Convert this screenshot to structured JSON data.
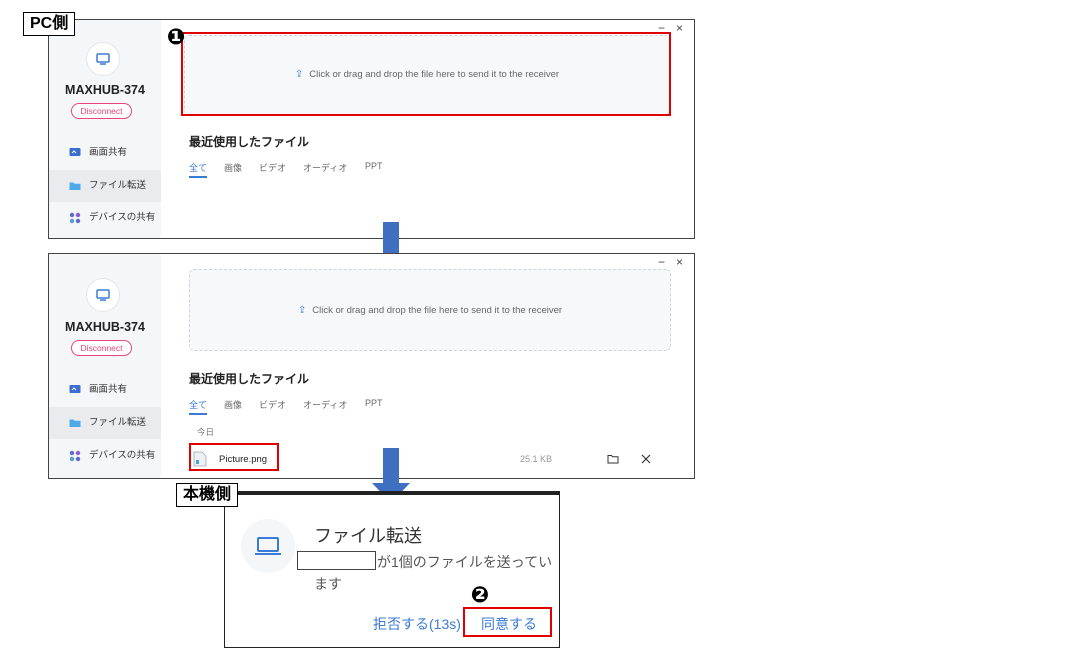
{
  "labels": {
    "pc_side": "PC側",
    "device_side": "本機側",
    "step1": "❶",
    "step2": "❷"
  },
  "window1": {
    "device_name": "MAXHUB-374",
    "disconnect": "Disconnect",
    "nav": [
      {
        "label": "画面共有",
        "icon": "screen-share-icon"
      },
      {
        "label": "ファイル転送",
        "icon": "folder-icon"
      },
      {
        "label": "デバイスの共有",
        "icon": "device-share-icon"
      }
    ],
    "dropzone_text": "Click or drag and drop the file here to send it to the receiver",
    "recent_title": "最近使用したファイル",
    "tabs": [
      "全て",
      "画像",
      "ビデオ",
      "オーディオ",
      "PPT"
    ],
    "minimize": "−",
    "close": "×"
  },
  "window2": {
    "device_name": "MAXHUB-374",
    "disconnect": "Disconnect",
    "nav": [
      {
        "label": "画面共有",
        "icon": "screen-share-icon"
      },
      {
        "label": "ファイル転送",
        "icon": "folder-icon"
      },
      {
        "label": "デバイスの共有",
        "icon": "device-share-icon"
      }
    ],
    "dropzone_text": "Click or drag and drop the file here to send it to the receiver",
    "recent_title": "最近使用したファイル",
    "tabs": [
      "全て",
      "画像",
      "ビデオ",
      "オーディオ",
      "PPT"
    ],
    "date_group": "今日",
    "file": {
      "name": "Picture.png",
      "size": "25.1 KB"
    },
    "minimize": "−",
    "close": "×"
  },
  "dialog": {
    "title": "ファイル転送",
    "message_line1": "が1個のファイルを送ってい",
    "message_line2": "ます",
    "reject": "拒否する(13s)",
    "accept": "同意する"
  },
  "colors": {
    "accent": "#3a7bd5",
    "highlight": "#e00000",
    "disconnect": "#e8457a",
    "arrow": "#3f6fc0"
  }
}
